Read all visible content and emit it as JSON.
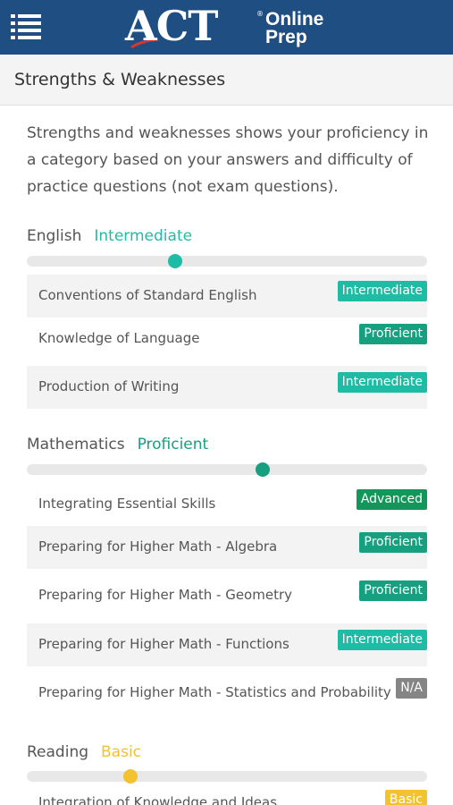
{
  "header": {
    "logo_main": "ACT",
    "logo_reg": "®",
    "logo_line1": "Online",
    "logo_line2": "Prep"
  },
  "subheader": {
    "title": "Strengths & Weaknesses"
  },
  "intro": "Strengths and weaknesses shows your proficiency in a category based on your answers and difficulty of practice questions (not exam questions).",
  "colors": {
    "header_bg": "#1f4e82",
    "intermediate": "#1fbca5",
    "proficient": "#16a07f",
    "advanced": "#12965a",
    "basic": "#f2c231",
    "na": "#858585"
  },
  "sections": [
    {
      "name": "English",
      "level": "Intermediate",
      "level_color": "#1fbca5",
      "progress": 0.37,
      "categories": [
        {
          "label": "Conventions of Standard English",
          "badge": "Intermediate",
          "badge_color": "#1fbca5"
        },
        {
          "label": "Knowledge of Language",
          "badge": "Proficient",
          "badge_color": "#16a07f"
        },
        {
          "label": "Production of Writing",
          "badge": "Intermediate",
          "badge_color": "#1fbca5"
        }
      ]
    },
    {
      "name": "Mathematics",
      "level": "Proficient",
      "level_color": "#16a07f",
      "progress": 0.59,
      "categories": [
        {
          "label": "Integrating Essential Skills",
          "badge": "Advanced",
          "badge_color": "#12965a"
        },
        {
          "label": "Preparing for Higher Math - Algebra",
          "badge": "Proficient",
          "badge_color": "#16a07f"
        },
        {
          "label": "Preparing for Higher Math - Geometry",
          "badge": "Proficient",
          "badge_color": "#16a07f"
        },
        {
          "label": "Preparing for Higher Math - Functions",
          "badge": "Intermediate",
          "badge_color": "#1fbca5"
        },
        {
          "label": "Preparing for Higher Math - Statistics and Probability",
          "badge": "N/A",
          "badge_color": "#858585"
        }
      ]
    },
    {
      "name": "Reading",
      "level": "Basic",
      "level_color": "#f2c231",
      "progress": 0.26,
      "categories": [
        {
          "label": "Integration of Knowledge and Ideas",
          "badge": "Basic",
          "badge_color": "#f2c231"
        }
      ]
    }
  ]
}
